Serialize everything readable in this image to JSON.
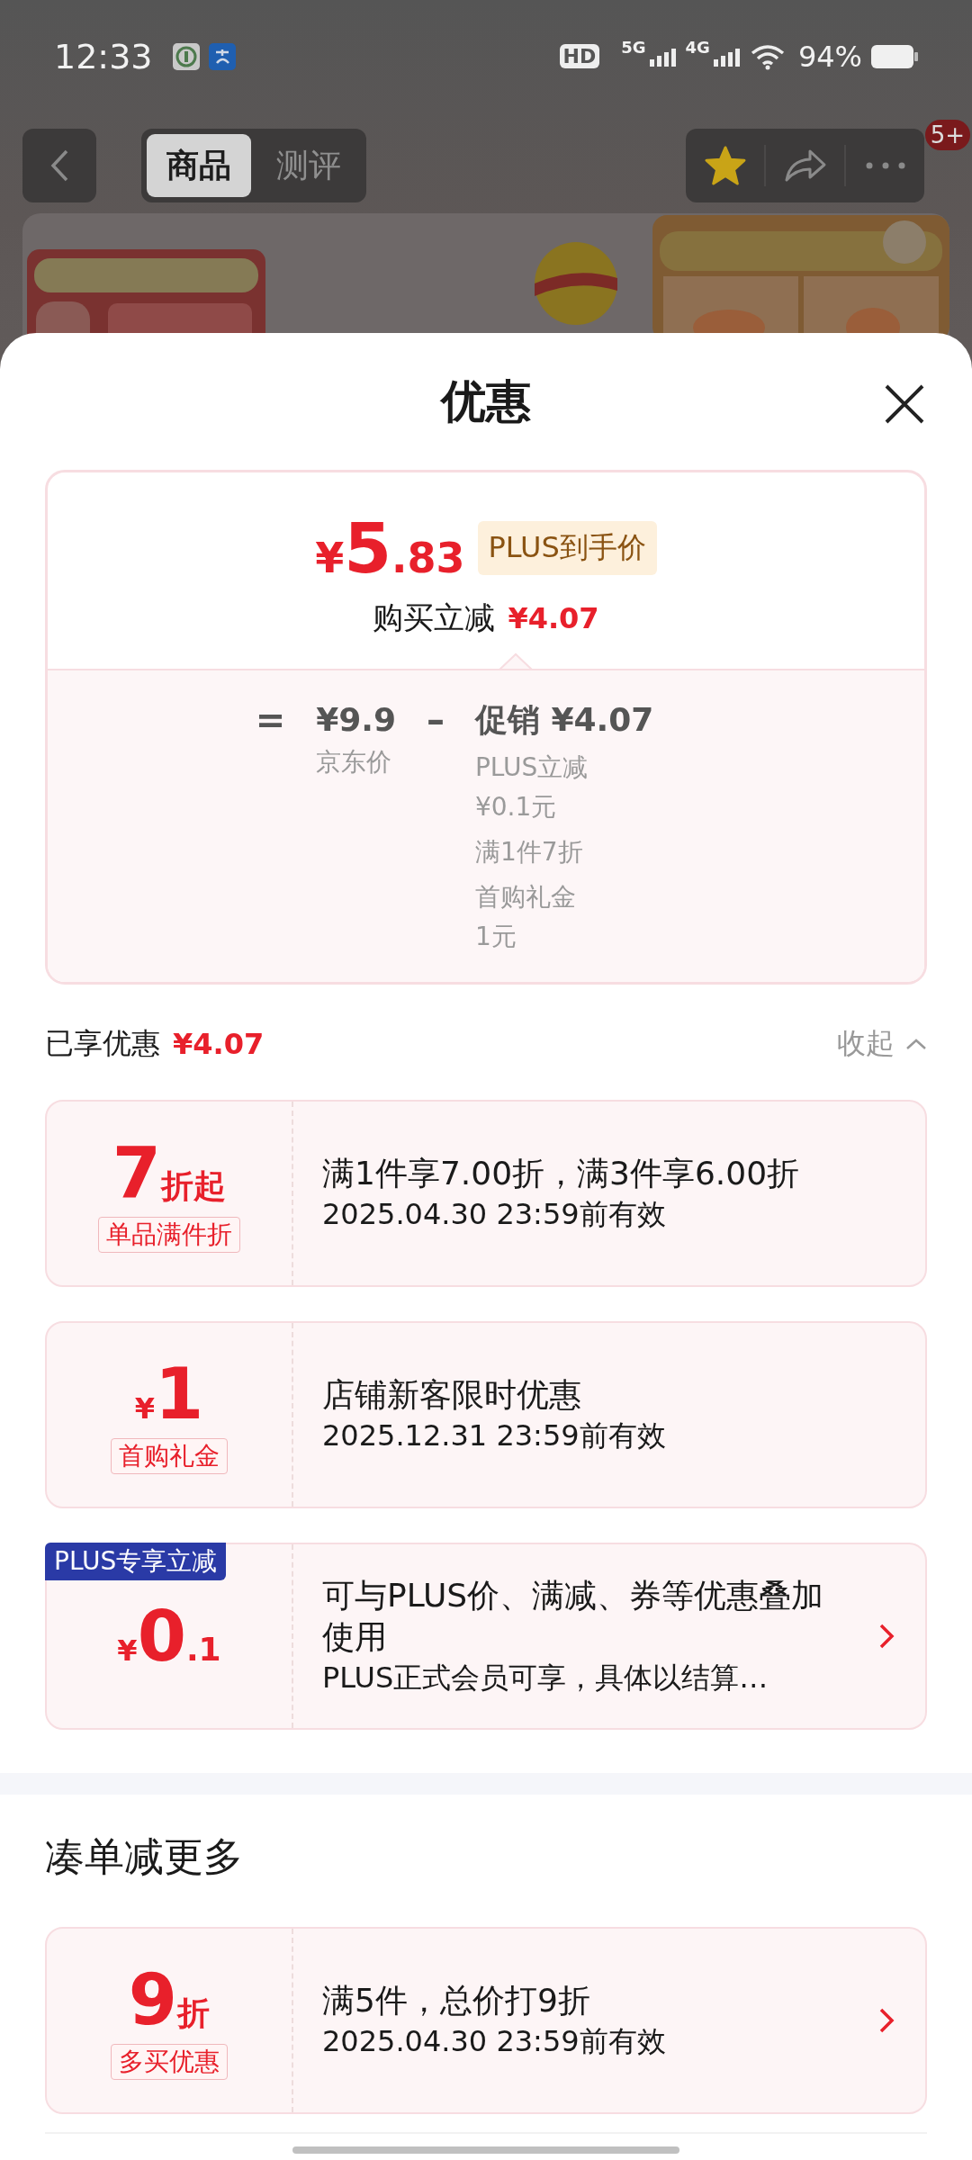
{
  "status_bar": {
    "time": "12:33",
    "hd": "HD",
    "networks": [
      "5G",
      "4G"
    ],
    "battery": "94%"
  },
  "header": {
    "tabs": [
      {
        "label": "商品",
        "selected": true
      },
      {
        "label": "测评",
        "selected": false
      }
    ],
    "favorited": true,
    "badge": "5+"
  },
  "sheet": {
    "title": "优惠",
    "price": {
      "currency": "¥",
      "integer": "5",
      "decimal": ".83",
      "tag": "PLUS到手价",
      "saving_label": "购买立减",
      "saving_amount": "¥4.07"
    },
    "breakdown": {
      "equals": "=",
      "base_price": "¥9.9",
      "base_label": "京东价",
      "minus": "–",
      "promo": "促销 ¥4.07",
      "promo_items": [
        {
          "lines": [
            "PLUS立减",
            "¥0.1元"
          ]
        },
        {
          "lines": [
            "满1件7折"
          ]
        },
        {
          "lines": [
            "首购礼金",
            "1元"
          ]
        }
      ]
    },
    "summary": {
      "label": "已享优惠",
      "amount": "¥4.07",
      "toggle": "收起",
      "expanded": true
    },
    "coupons": [
      {
        "value": "7",
        "suffix": "折起",
        "tag": "单品满件折",
        "title": "满1件享7.00折，满3件享6.00折",
        "subtitle": "2025.04.30 23:59前有效",
        "arrow": false
      },
      {
        "prefix": "¥",
        "value": "1",
        "tag": "首购礼金",
        "title": "店铺新客限时优惠",
        "subtitle": "2025.12.31 23:59前有效",
        "arrow": false
      },
      {
        "badge": "PLUS专享立减",
        "prefix": "¥",
        "value": "0",
        "suffix": ".1",
        "title": "可与PLUS价、满减、券等优惠叠加使用",
        "subtitle": "PLUS正式会员可享，具体以结算…",
        "arrow": true
      }
    ],
    "more": {
      "heading": "凑单减更多",
      "coupons": [
        {
          "value": "9",
          "suffix": "折",
          "tag": "多买优惠",
          "title": "满5件，总价打9折",
          "subtitle": "2025.04.30 23:59前有效",
          "arrow": true
        }
      ]
    }
  }
}
